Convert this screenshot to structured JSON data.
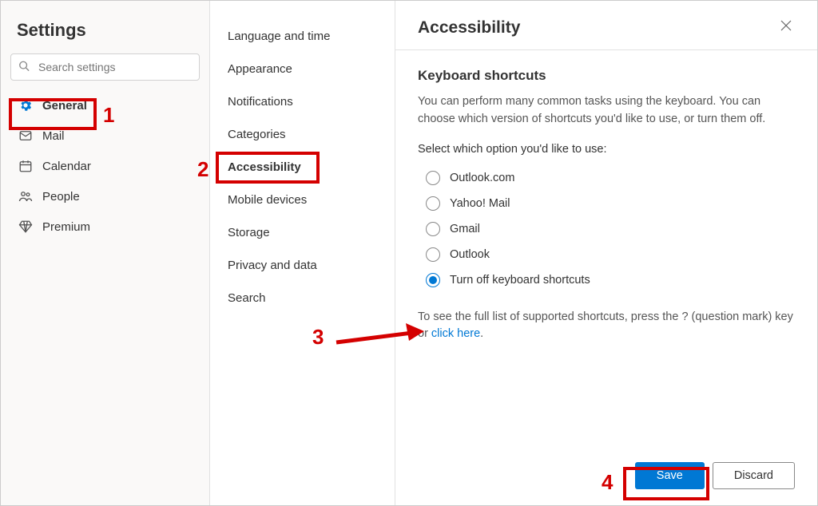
{
  "title": "Settings",
  "search": {
    "placeholder": "Search settings"
  },
  "nav": {
    "items": [
      {
        "label": "General",
        "icon": "gear",
        "selected": true
      },
      {
        "label": "Mail",
        "icon": "mail"
      },
      {
        "label": "Calendar",
        "icon": "calendar"
      },
      {
        "label": "People",
        "icon": "people"
      },
      {
        "label": "Premium",
        "icon": "diamond"
      }
    ]
  },
  "subnav": {
    "items": [
      {
        "label": "Language and time"
      },
      {
        "label": "Appearance"
      },
      {
        "label": "Notifications"
      },
      {
        "label": "Categories"
      },
      {
        "label": "Accessibility",
        "selected": true
      },
      {
        "label": "Mobile devices"
      },
      {
        "label": "Storage"
      },
      {
        "label": "Privacy and data"
      },
      {
        "label": "Search"
      }
    ]
  },
  "panel": {
    "title": "Accessibility",
    "section_title": "Keyboard shortcuts",
    "description": "You can perform many common tasks using the keyboard. You can choose which version of shortcuts you'd like to use, or turn them off.",
    "prompt": "Select which option you'd like to use:",
    "options": [
      {
        "label": "Outlook.com",
        "checked": false
      },
      {
        "label": "Yahoo! Mail",
        "checked": false
      },
      {
        "label": "Gmail",
        "checked": false
      },
      {
        "label": "Outlook",
        "checked": false
      },
      {
        "label": "Turn off keyboard shortcuts",
        "checked": true
      }
    ],
    "hint_prefix": "To see the full list of supported shortcuts, press the ? (question mark) key or ",
    "hint_link": "click here",
    "hint_suffix": ".",
    "save_label": "Save",
    "discard_label": "Discard"
  },
  "annotations": {
    "n1": "1",
    "n2": "2",
    "n3": "3",
    "n4": "4"
  }
}
